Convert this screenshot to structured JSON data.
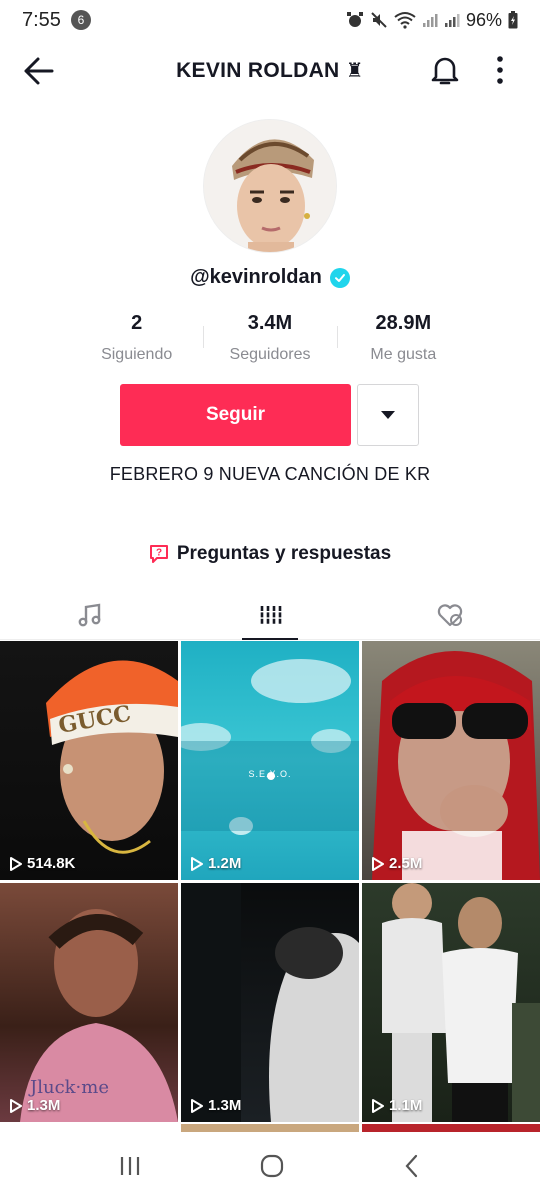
{
  "status": {
    "time": "7:55",
    "notifications": "6",
    "battery": "96%"
  },
  "header": {
    "title": "KEVIN ROLDAN"
  },
  "profile": {
    "username": "@kevinroldan",
    "stats": [
      {
        "value": "2",
        "label": "Siguiendo"
      },
      {
        "value": "3.4M",
        "label": "Seguidores"
      },
      {
        "value": "28.9M",
        "label": "Me gusta"
      }
    ],
    "follow_label": "Seguir",
    "bio": "FEBRERO 9 NUEVA CANCIÓN DE KR",
    "qa_label": "Preguntas y respuestas"
  },
  "tabs": [
    "music-icon",
    "grid-icon",
    "liked-icon"
  ],
  "videos": [
    {
      "views": "514.8K",
      "overlay": ""
    },
    {
      "views": "1.2M",
      "overlay": "S.E.X.O."
    },
    {
      "views": "2.5M",
      "overlay": ""
    },
    {
      "views": "1.3M",
      "overlay": ""
    },
    {
      "views": "1.3M",
      "overlay": ""
    },
    {
      "views": "1.1M",
      "overlay": ""
    }
  ],
  "colors": {
    "accent": "#fe2c55",
    "verified": "#20d5ec",
    "text": "#161823",
    "muted": "#8a8b91"
  }
}
